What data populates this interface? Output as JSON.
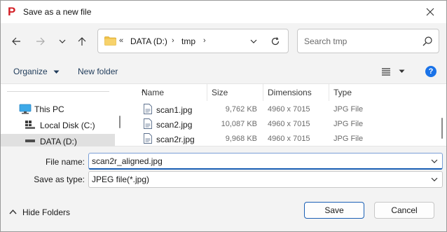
{
  "window": {
    "title": "Save as a new file",
    "close_icon": "close-icon",
    "app_icon": "p-logo-icon",
    "app_icon_glyph": "P",
    "accent": "#d31f26"
  },
  "nav": {
    "back_icon": "arrow-left-icon",
    "forward_icon": "arrow-right-icon",
    "recent_icon": "chevron-down-icon",
    "up_icon": "arrow-up-icon",
    "address": {
      "overflow": "«",
      "crumbs": [
        "DATA (D:)",
        "tmp"
      ],
      "separator": "›",
      "dropdown_icon": "chevron-down-icon",
      "refresh_icon": "refresh-icon"
    },
    "search": {
      "placeholder": "Search tmp",
      "icon": "search-icon"
    }
  },
  "commandbar": {
    "organize": "Organize",
    "new_folder": "New folder",
    "view_icon": "list-view-icon",
    "help_icon": "help-icon",
    "help_glyph": "?"
  },
  "navpane": {
    "items": [
      {
        "label": "This PC",
        "icon": "monitor-icon"
      },
      {
        "label": "Local Disk (C:)",
        "icon": "windows-drive-icon"
      },
      {
        "label": "DATA (D:)",
        "icon": "drive-icon",
        "selected": true
      }
    ]
  },
  "files": {
    "columns": [
      "Name",
      "Size",
      "Dimensions",
      "Type"
    ],
    "sort_indicator": "^",
    "rows": [
      {
        "name": "scan1.jpg",
        "size": "9,762 KB",
        "dimensions": "4960 x 7015",
        "type": "JPG File"
      },
      {
        "name": "scan2.jpg",
        "size": "10,087 KB",
        "dimensions": "4960 x 7015",
        "type": "JPG File"
      },
      {
        "name": "scan2r.jpg",
        "size": "9,968 KB",
        "dimensions": "4960 x 7015",
        "type": "JPG File"
      }
    ]
  },
  "form": {
    "filename_label": "File name:",
    "filename_value": "scan2r_aligned.jpg",
    "type_label": "Save as type:",
    "type_value": "JPEG file(*.jpg)"
  },
  "footer": {
    "hide_folders": "Hide Folders",
    "save": "Save",
    "cancel": "Cancel"
  }
}
